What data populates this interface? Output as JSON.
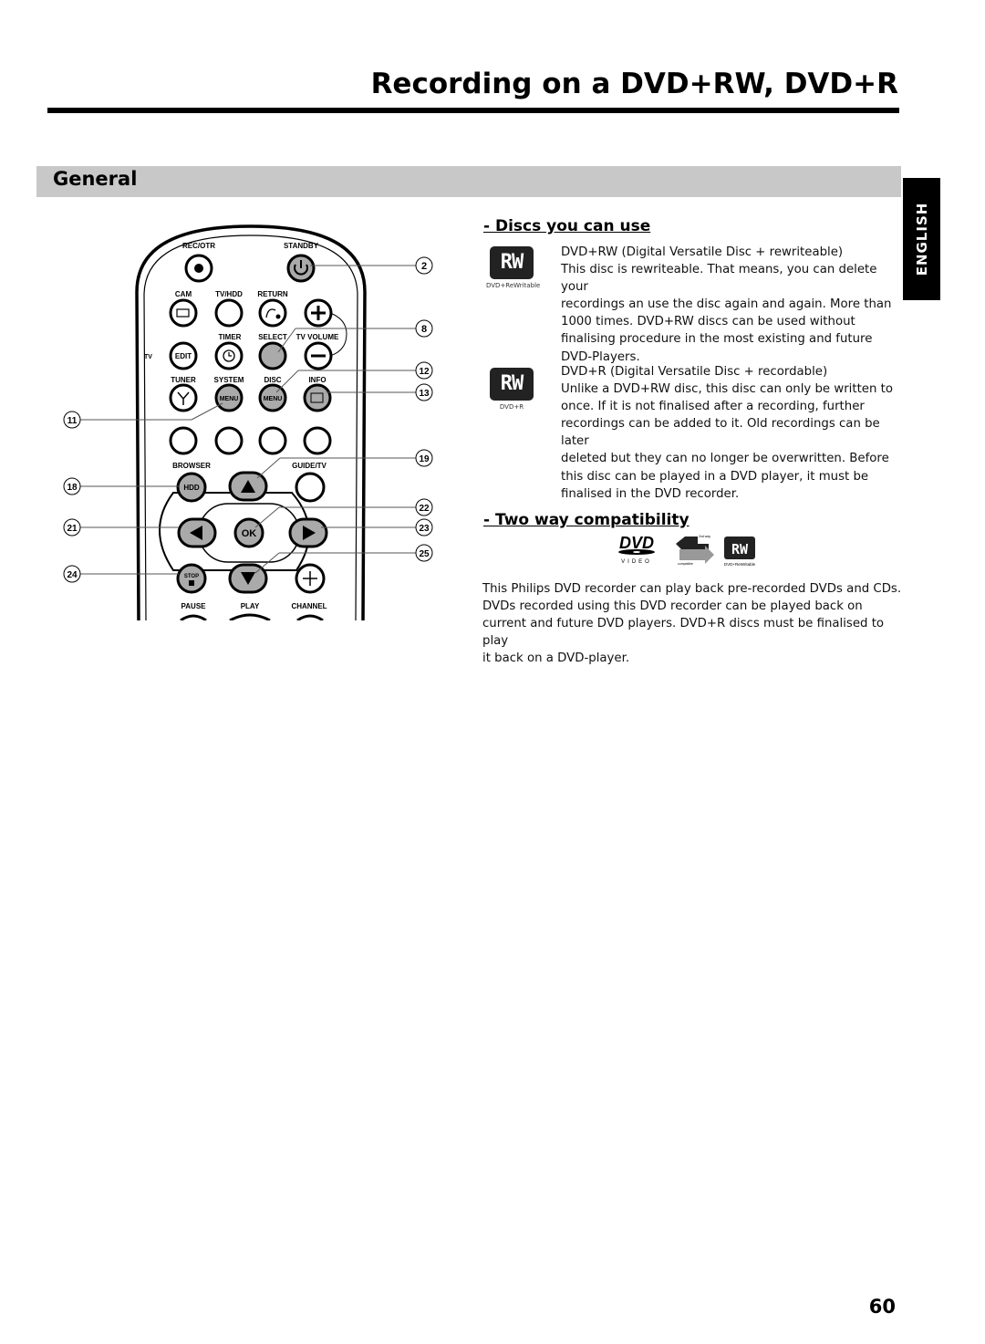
{
  "header": {
    "title": "Recording on a DVD+RW, DVD+R"
  },
  "section": {
    "title": "General"
  },
  "language_tab": "ENGLISH",
  "remote": {
    "labels": {
      "rec_otr": "REC/OTR",
      "standby": "STANDBY",
      "cam": "CAM",
      "tv_hdd": "TV/HDD",
      "return": "RETURN",
      "timer": "TIMER",
      "select": "SELECT",
      "tv_volume": "TV VOLUME",
      "tv": "TV",
      "edit": "EDIT",
      "tuner": "TUNER",
      "system": "SYSTEM",
      "disc": "DISC",
      "info": "INFO",
      "menu": "MENU",
      "browser": "BROWSER",
      "hdd": "HDD",
      "guide_tv": "GUIDE/TV",
      "ok": "OK",
      "stop": "STOP",
      "pause": "PAUSE",
      "play": "PLAY",
      "channel": "CHANNEL"
    },
    "callouts_right": [
      "2",
      "8",
      "12",
      "13",
      "19",
      "22",
      "23",
      "25"
    ],
    "callouts_left": [
      "11",
      "18",
      "21",
      "24"
    ]
  },
  "discs": {
    "heading": "- Discs you can use",
    "items": [
      {
        "logo_text": "RW",
        "logo_caption": "DVD+ReWritable",
        "title": "DVD+RW (Digital Versatile Disc + rewriteable)",
        "lines": [
          "This disc is rewriteable. That means, you can delete your",
          "recordings an use the disc again and again. More than",
          "1000 times. DVD+RW discs can be used without",
          "finalising procedure in the most existing and future",
          "DVD-Players."
        ]
      },
      {
        "logo_text": "RW",
        "logo_caption": "DVD+R",
        "title": "DVD+R (Digital Versatile Disc + recordable)",
        "lines": [
          "Unlike a DVD+RW disc, this disc can only be written to",
          "once. If it is not finalised after a recording, further",
          "recordings can be added to it. Old recordings can be later",
          "deleted but they can no longer be overwritten. Before",
          "this disc can be played in a DVD player, it must be",
          "finalised in the DVD recorder."
        ]
      }
    ]
  },
  "compatibility": {
    "heading": "- Two way compatibility",
    "logos": {
      "dvd_video": "VIDEO",
      "dvd_text": "DVD",
      "arrow_top": "2nd way",
      "arrow_bottom": "compatible",
      "rw_text": "RW",
      "rw_caption": "DVD+ReWritable"
    },
    "lines": [
      "This Philips DVD recorder can play back pre-recorded DVDs and CDs.",
      "DVDs recorded using this DVD recorder can be played back on",
      "current and future DVD players. DVD+R discs must be finalised to play",
      "it back on a DVD-player."
    ]
  },
  "page_number": "60"
}
